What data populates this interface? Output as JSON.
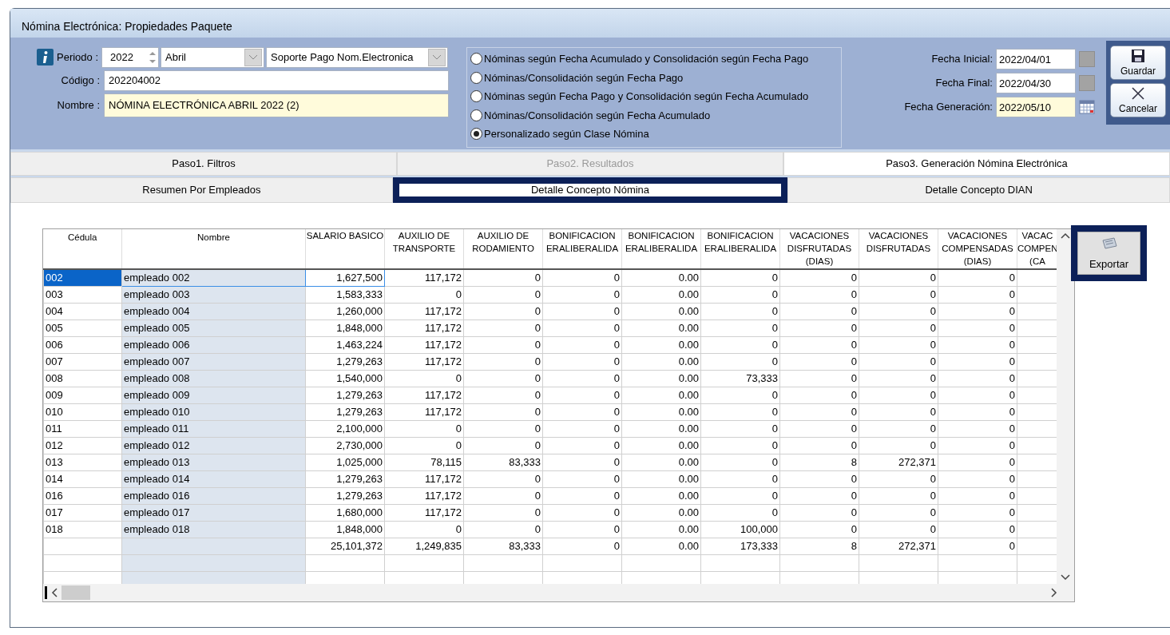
{
  "window": {
    "title": "Nómina Electrónica: Propiedades Paquete"
  },
  "header": {
    "periodo_label": "Periodo :",
    "year": "2022",
    "month": "Abril",
    "type": "Soporte Pago Nom.Electronica",
    "codigo_label": "Código :",
    "codigo": "202204002",
    "nombre_label": "Nombre :",
    "nombre": "NÓMINA ELECTRÓNICA ABRIL 2022 (2)"
  },
  "options": [
    {
      "label": "Nóminas según Fecha Acumulado y Consolidación según Fecha Pago",
      "selected": false
    },
    {
      "label": "Nóminas/Consolidación según Fecha Pago",
      "selected": false
    },
    {
      "label": "Nóminas según Fecha Pago y Consolidación según Fecha Acumulado",
      "selected": false
    },
    {
      "label": "Nóminas/Consolidación según Fecha Acumulado",
      "selected": false
    },
    {
      "label": "Personalizado según Clase Nómina",
      "selected": true
    }
  ],
  "dates": [
    {
      "label": "Fecha Inicial:",
      "value": "2022/04/01",
      "kind": "plain"
    },
    {
      "label": "Fecha Final:",
      "value": "2022/04/30",
      "kind": "plain"
    },
    {
      "label": "Fecha Generación:",
      "value": "2022/05/10",
      "kind": "calendar"
    }
  ],
  "actions": [
    {
      "label": "Guardar",
      "kind": "save"
    },
    {
      "label": "Cancelar",
      "kind": "cancel"
    }
  ],
  "tabs": [
    {
      "label": "Paso1. Filtros",
      "selected": false,
      "disabled": false
    },
    {
      "label": "Paso2. Resultados",
      "selected": false,
      "disabled": true
    },
    {
      "label": "Paso3. Generación Nómina Electrónica",
      "selected": true,
      "disabled": false
    }
  ],
  "subtabs": [
    {
      "label": "Resumen Por Empleados",
      "selected": false
    },
    {
      "label": "Detalle Concepto Nómina",
      "selected": true
    },
    {
      "label": "Detalle Concepto DIAN",
      "selected": false
    }
  ],
  "export_button": "Exportar",
  "table": {
    "columns": [
      "Cédula",
      "Nombre",
      "SALARIO BASICO",
      "AUXILIO DE TRANSPORTE",
      "AUXILIO DE RODAMIENTO",
      "BONIFICACION ERALIBERALIDA",
      "BONIFICACION ERALIBERALIDA",
      "BONIFICACION ERALIBERALIDA",
      "VACACIONES DISFRUTADAS (DIAS)",
      "VACACIONES DISFRUTADAS",
      "VACACIONES COMPENSADAS (DIAS)",
      "VACAC COMPEN (CA"
    ],
    "rows": [
      {
        "cedula": "002",
        "nombre": "empleado 002",
        "values": [
          "1,627,500",
          "117,172",
          "0",
          "0",
          "0.00",
          "0",
          "0",
          "0",
          "0"
        ],
        "selected": true
      },
      {
        "cedula": "003",
        "nombre": "empleado 003",
        "values": [
          "1,583,333",
          "0",
          "0",
          "0",
          "0.00",
          "0",
          "0",
          "0",
          "0"
        ],
        "selected": false
      },
      {
        "cedula": "004",
        "nombre": "empleado 004",
        "values": [
          "1,260,000",
          "117,172",
          "0",
          "0",
          "0.00",
          "0",
          "0",
          "0",
          "0"
        ],
        "selected": false
      },
      {
        "cedula": "005",
        "nombre": "empleado 005",
        "values": [
          "1,848,000",
          "117,172",
          "0",
          "0",
          "0.00",
          "0",
          "0",
          "0",
          "0"
        ],
        "selected": false
      },
      {
        "cedula": "006",
        "nombre": "empleado 006",
        "values": [
          "1,463,224",
          "117,172",
          "0",
          "0",
          "0.00",
          "0",
          "0",
          "0",
          "0"
        ],
        "selected": false
      },
      {
        "cedula": "007",
        "nombre": "empleado 007",
        "values": [
          "1,279,263",
          "117,172",
          "0",
          "0",
          "0.00",
          "0",
          "0",
          "0",
          "0"
        ],
        "selected": false
      },
      {
        "cedula": "008",
        "nombre": "empleado 008",
        "values": [
          "1,540,000",
          "0",
          "0",
          "0",
          "0.00",
          "73,333",
          "0",
          "0",
          "0"
        ],
        "selected": false
      },
      {
        "cedula": "009",
        "nombre": "empleado 009",
        "values": [
          "1,279,263",
          "117,172",
          "0",
          "0",
          "0.00",
          "0",
          "0",
          "0",
          "0"
        ],
        "selected": false
      },
      {
        "cedula": "010",
        "nombre": "empleado 010",
        "values": [
          "1,279,263",
          "117,172",
          "0",
          "0",
          "0.00",
          "0",
          "0",
          "0",
          "0"
        ],
        "selected": false
      },
      {
        "cedula": "011",
        "nombre": "empleado 011",
        "values": [
          "2,100,000",
          "0",
          "0",
          "0",
          "0.00",
          "0",
          "0",
          "0",
          "0"
        ],
        "selected": false
      },
      {
        "cedula": "012",
        "nombre": "empleado 012",
        "values": [
          "2,730,000",
          "0",
          "0",
          "0",
          "0.00",
          "0",
          "0",
          "0",
          "0"
        ],
        "selected": false
      },
      {
        "cedula": "013",
        "nombre": "empleado 013",
        "values": [
          "1,025,000",
          "78,115",
          "83,333",
          "0",
          "0.00",
          "0",
          "8",
          "272,371",
          "0"
        ],
        "selected": false
      },
      {
        "cedula": "014",
        "nombre": "empleado 014",
        "values": [
          "1,279,263",
          "117,172",
          "0",
          "0",
          "0.00",
          "0",
          "0",
          "0",
          "0"
        ],
        "selected": false
      },
      {
        "cedula": "016",
        "nombre": "empleado 016",
        "values": [
          "1,279,263",
          "117,172",
          "0",
          "0",
          "0.00",
          "0",
          "0",
          "0",
          "0"
        ],
        "selected": false
      },
      {
        "cedula": "017",
        "nombre": "empleado 017",
        "values": [
          "1,680,000",
          "117,172",
          "0",
          "0",
          "0.00",
          "0",
          "0",
          "0",
          "0"
        ],
        "selected": false
      },
      {
        "cedula": "018",
        "nombre": "empleado 018",
        "values": [
          "1,848,000",
          "0",
          "0",
          "0",
          "0.00",
          "100,000",
          "0",
          "0",
          "0"
        ],
        "selected": false
      }
    ],
    "totals": [
      "25,101,372",
      "1,249,835",
      "83,333",
      "0",
      "0.00",
      "173,333",
      "8",
      "272,371",
      "0"
    ]
  }
}
